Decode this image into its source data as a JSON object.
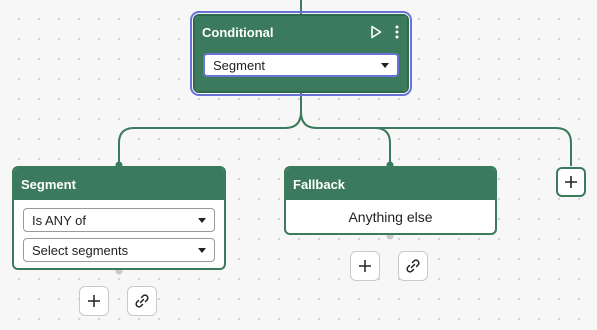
{
  "conditional": {
    "title": "Conditional",
    "selected": "Segment",
    "icons": [
      "play-icon",
      "more-vertical-icon"
    ]
  },
  "branches": {
    "segment": {
      "title": "Segment",
      "operator": "Is ANY of",
      "segments_placeholder": "Select segments"
    },
    "fallback": {
      "title": "Fallback",
      "text": "Anything else"
    }
  },
  "actions": {
    "add_icon": "plus-icon",
    "link_icon": "link-icon"
  },
  "colors": {
    "node_green": "#3b7a5c",
    "selection_outline": "#6a72d6",
    "canvas": "#f7f7f7"
  }
}
